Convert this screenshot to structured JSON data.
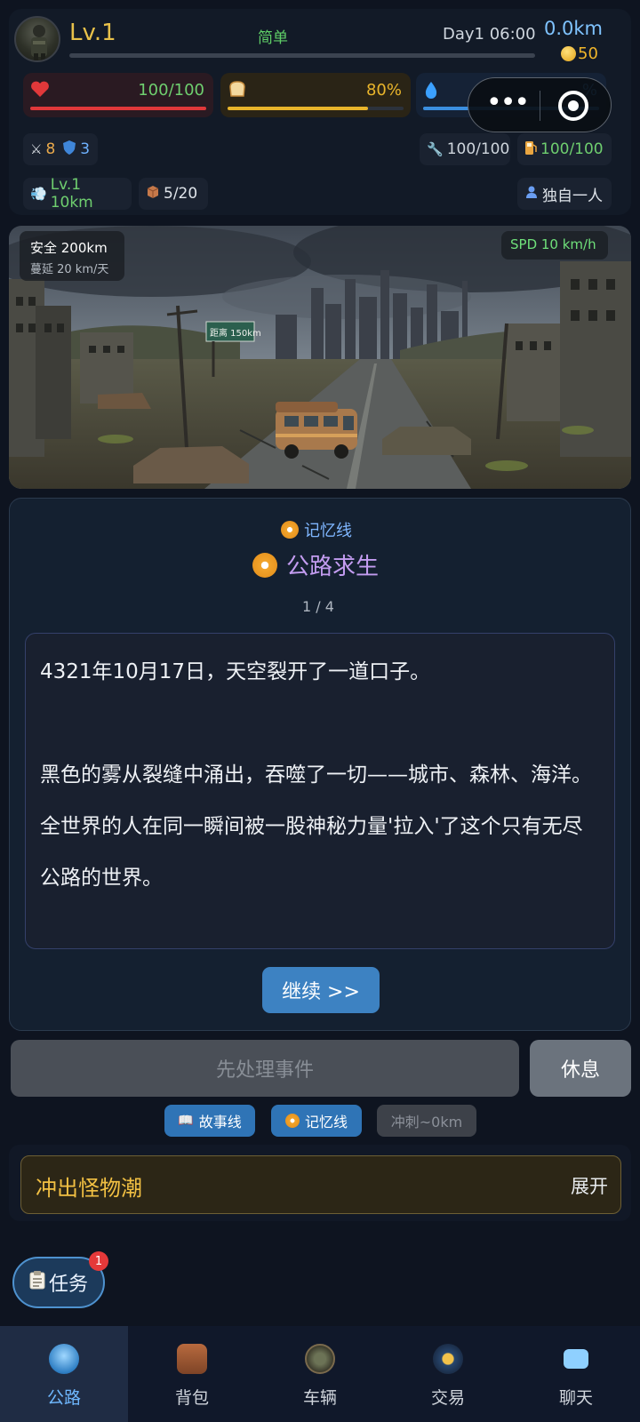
{
  "header": {
    "level": "Lv.1",
    "difficulty": "简单",
    "day_time": "Day1 06:00",
    "distance": "0.0km",
    "coins": "50"
  },
  "vitals": {
    "health": {
      "value": "100/100",
      "percent": 100,
      "color": "#e0383a"
    },
    "food": {
      "value": "80%",
      "percent": 80,
      "color": "#e9b52b"
    },
    "water": {
      "value": "%",
      "percent": 100,
      "color": "#3b8fe0"
    }
  },
  "combat": {
    "attack": "8",
    "defense": "3"
  },
  "vehicle": {
    "durability": "100/100",
    "fuel": "100/100"
  },
  "travel": {
    "engine": "Lv.1 10km",
    "cargo": "5/20"
  },
  "party": {
    "status": "独自一人"
  },
  "scene": {
    "safe_label": "安全 200km",
    "spread_label": "蔓延 20 km/天",
    "speed_label": "SPD 10 km/h",
    "sign_text": "距离 150km"
  },
  "story": {
    "category": "记忆线",
    "title": "公路求生",
    "page": "1 / 4",
    "paragraphs": [
      "4321年10月17日，天空裂开了一道口子。",
      "",
      "黑色的雾从裂缝中涌出，吞噬了一切——城市、森林、海洋。",
      "全世界的人在同一瞬间被一股神秘力量'拉入'了这个只有无尽公路的世界。"
    ],
    "continue_label": "继续 >>"
  },
  "actions": {
    "handle_event": "先处理事件",
    "rest": "休息"
  },
  "filters": {
    "story_line": "故事线",
    "memory_line": "记忆线",
    "sprint": "冲刺~0km"
  },
  "event": {
    "title": "冲出怪物潮",
    "toggle": "展开"
  },
  "tasks": {
    "label": "任务",
    "badge": "1"
  },
  "nav": [
    {
      "label": "公路",
      "icon": "road-icon"
    },
    {
      "label": "背包",
      "icon": "backpack-icon"
    },
    {
      "label": "车辆",
      "icon": "vehicle-icon"
    },
    {
      "label": "交易",
      "icon": "trade-icon"
    },
    {
      "label": "聊天",
      "icon": "chat-icon"
    }
  ]
}
